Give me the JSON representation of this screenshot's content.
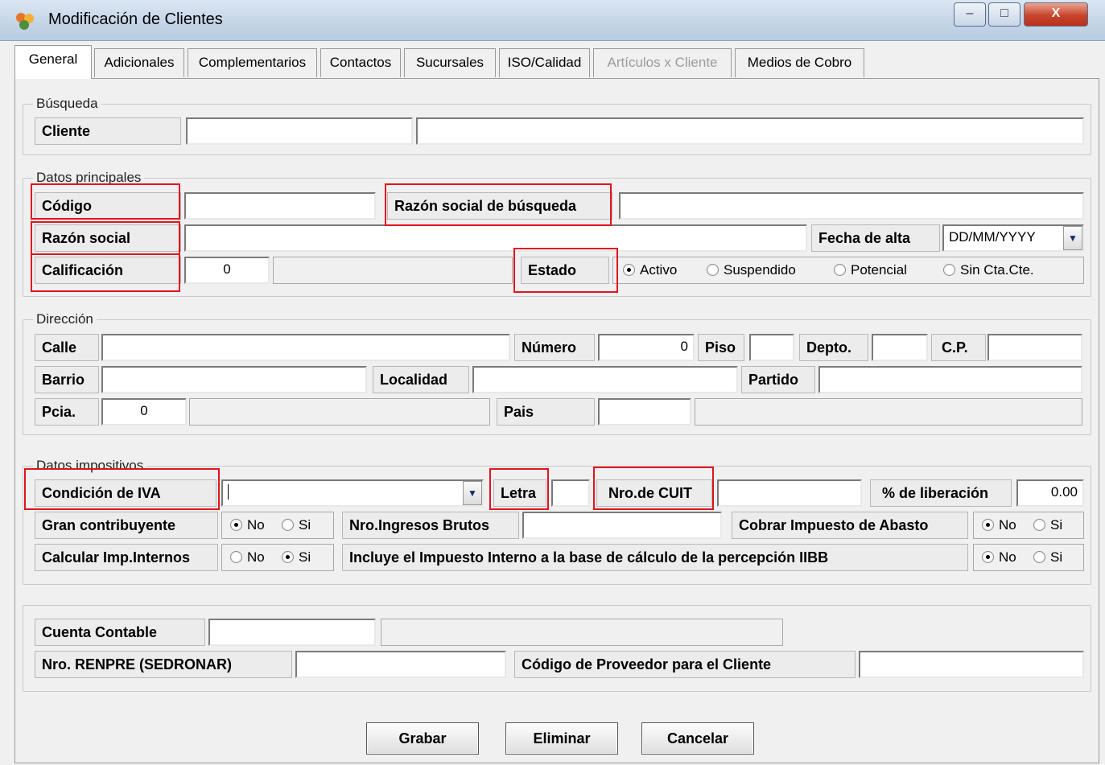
{
  "window": {
    "title": "Modificación de Clientes",
    "minimize": "–",
    "maximize": "□",
    "close": "X"
  },
  "tabs": [
    "General",
    "Adicionales",
    "Complementarios",
    "Contactos",
    "Sucursales",
    "ISO/Calidad",
    "Artículos x Cliente",
    "Medios de Cobro"
  ],
  "busqueda": {
    "legend": "Búsqueda",
    "cliente_label": "Cliente"
  },
  "principales": {
    "legend": "Datos principales",
    "codigo_label": "Código",
    "razon_busqueda_label": "Razón social de búsqueda",
    "razon_label": "Razón social",
    "fecha_label": "Fecha de alta",
    "fecha_value": "DD/MM/YYYY",
    "calificacion_label": "Calificación",
    "calificacion_value": "0",
    "estado_label": "Estado",
    "estado_options": [
      "Activo",
      "Suspendido",
      "Potencial",
      "Sin Cta.Cte."
    ],
    "estado_selected": "Activo"
  },
  "direccion": {
    "legend": "Dirección",
    "calle_label": "Calle",
    "numero_label": "Número",
    "numero_value": "0",
    "piso_label": "Piso",
    "depto_label": "Depto.",
    "cp_label": "C.P.",
    "barrio_label": "Barrio",
    "localidad_label": "Localidad",
    "partido_label": "Partido",
    "pcia_label": "Pcia.",
    "pcia_value": "0",
    "pais_label": "Pais"
  },
  "impositivos": {
    "legend": "Datos impositivos",
    "iva_label": "Condición de IVA",
    "letra_label": "Letra",
    "cuit_label": "Nro.de CUIT",
    "liberacion_label": "% de liberación",
    "liberacion_value": "0.00",
    "gran_label": "Gran contribuyente",
    "ingresos_label": "Nro.Ingresos Brutos",
    "abasto_label": "Cobrar Impuesto de Abasto",
    "internos_label": "Calcular Imp.Internos",
    "incluye_label": "Incluye el Impuesto Interno a la base de cálculo de la percepción IIBB",
    "no": "No",
    "si": "Si"
  },
  "otros": {
    "cuenta_label": "Cuenta Contable",
    "renpre_label": "Nro. RENPRE (SEDRONAR)",
    "proveedor_label": "Código de Proveedor para el Cliente"
  },
  "buttons": {
    "grabar": "Grabar",
    "eliminar": "Eliminar",
    "cancelar": "Cancelar"
  }
}
